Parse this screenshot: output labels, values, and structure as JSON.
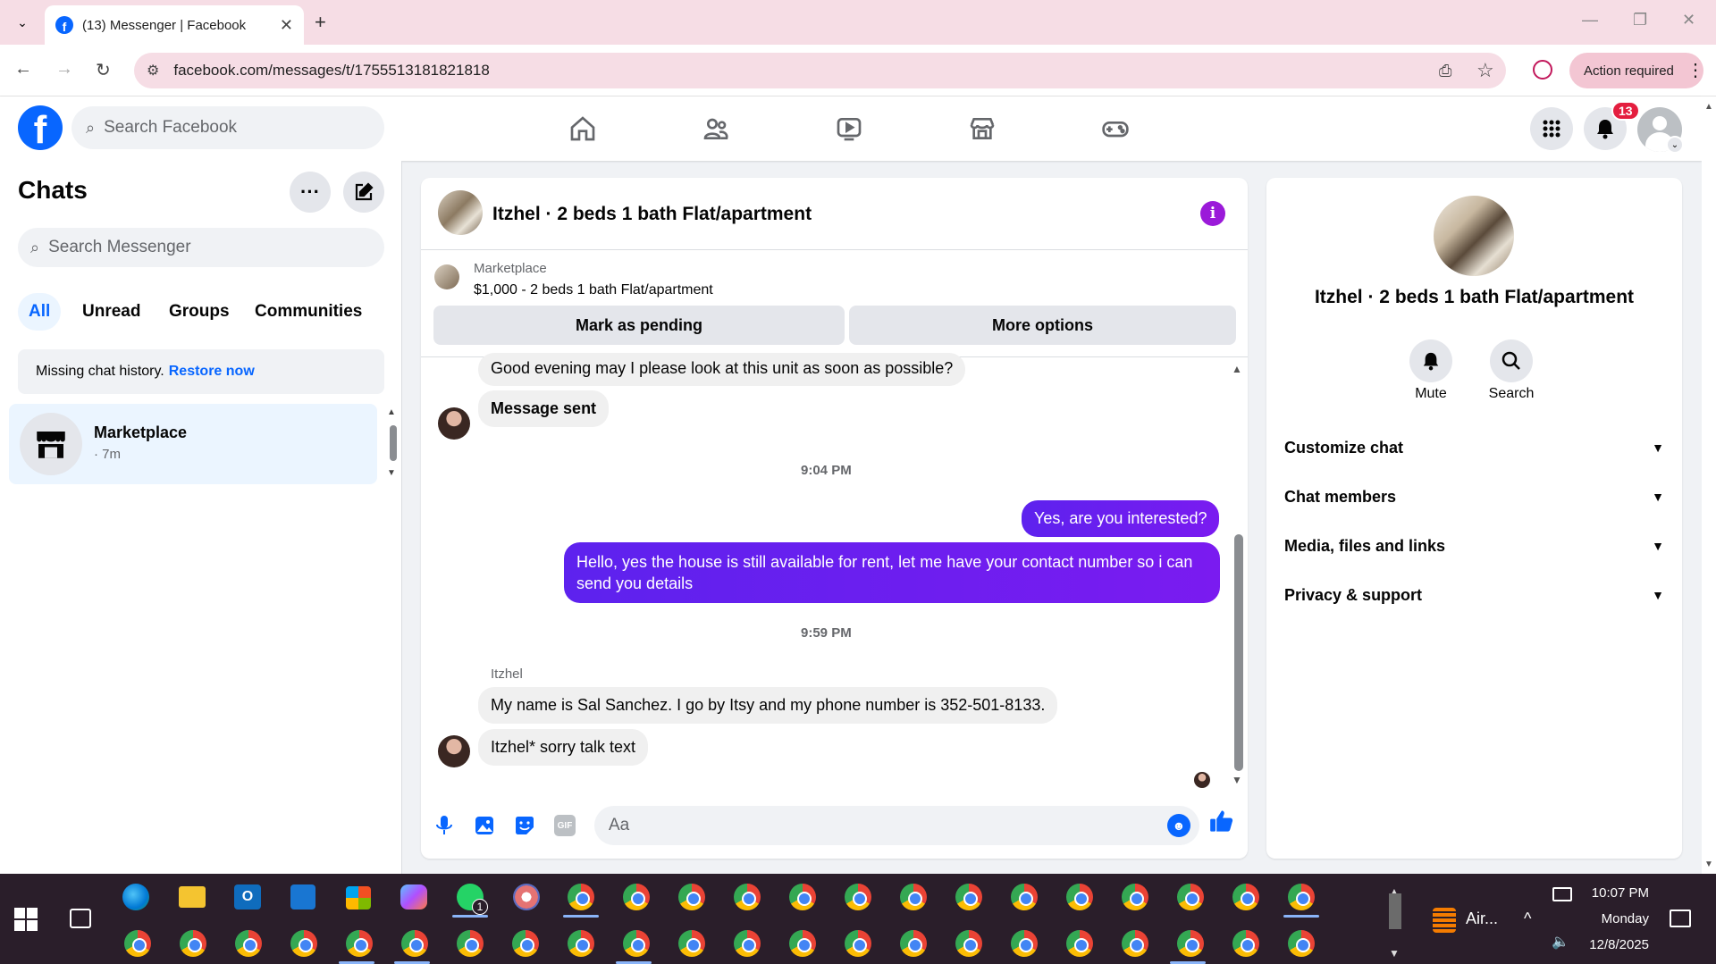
{
  "browser": {
    "tab_title": "(13) Messenger | Facebook",
    "url": "facebook.com/messages/t/1755513181821818",
    "action_required": "Action required"
  },
  "fb_header": {
    "search_placeholder": "Search Facebook",
    "notification_count": "13",
    "nav_icons": [
      "home-icon",
      "friends-icon",
      "video-icon",
      "marketplace-icon",
      "gaming-icon"
    ]
  },
  "chats": {
    "title": "Chats",
    "search_placeholder": "Search Messenger",
    "filters": [
      "All",
      "Unread",
      "Groups",
      "Communities"
    ],
    "active_filter": "All",
    "missing_history": "Missing chat history.",
    "restore_link": "Restore now",
    "items": [
      {
        "name": "Marketplace",
        "time": "· 7m"
      }
    ]
  },
  "conversation": {
    "title": "Itzhel · 2 beds 1 bath Flat/apartment",
    "marketplace_label": "Marketplace",
    "listing": "$1,000 - 2 beds 1 bath Flat/apartment",
    "btn_pending": "Mark as pending",
    "btn_more": "More options",
    "messages": {
      "m1": "Good evening may I please look at this unit as soon as possible?",
      "m2": "Message sent",
      "ts1": "9:04 PM",
      "m3": "Yes, are you interested?",
      "m4": "Hello, yes the house is still available for rent, let me have your contact number so i can send you details",
      "ts2": "9:59 PM",
      "sender": "Itzhel",
      "m5": "My name is Sal Sanchez. I go by Itsy and my phone number is 352-501-8133.",
      "m6": "Itzhel* sorry talk text"
    },
    "composer_placeholder": "Aa"
  },
  "info_panel": {
    "title": "Itzhel · 2 beds 1 bath Flat/apartment",
    "mute_label": "Mute",
    "search_label": "Search",
    "sections": [
      "Customize chat",
      "Chat members",
      "Media, files and links",
      "Privacy & support"
    ]
  },
  "taskbar": {
    "tray_app_label": "Air...",
    "time": "10:07 PM",
    "day": "Monday",
    "date": "12/8/2025",
    "whatsapp_badge": "1"
  },
  "colors": {
    "fb_blue": "#0866ff",
    "outgoing_bubble": "#6b1cf0",
    "notif_red": "#e41e3f",
    "tab_bar": "#f6dde5"
  }
}
